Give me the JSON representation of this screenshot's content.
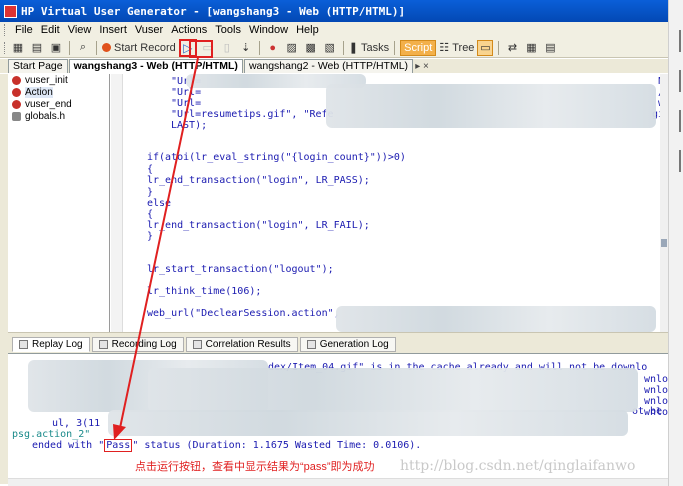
{
  "window": {
    "title": "HP Virtual User Generator - [wangshang3 - Web (HTTP/HTML)]"
  },
  "menu": {
    "items": [
      "File",
      "Edit",
      "View",
      "Insert",
      "Vuser",
      "Actions",
      "Tools",
      "Window",
      "Help"
    ]
  },
  "toolbar": {
    "start_record_label": "Start Record",
    "play_icon": "▷",
    "tasks_label": "Tasks",
    "script_label": "Script",
    "tree_label": "Tree"
  },
  "doc_tabs": {
    "items": [
      "Start Page",
      "wangshang3 - Web (HTTP/HTML)",
      "wangshang2 - Web (HTTP/HTML)"
    ],
    "close_glyph": "▸ ×"
  },
  "tree": {
    "items": [
      "vuser_init",
      "Action",
      "vuser_end",
      "globals.h"
    ]
  },
  "code": {
    "lines": [
      "\"Url=",
      "\"Url=",
      "\"Url=",
      "\"Url=resumetips.gif\", \"Refe",
      "LAST);",
      "if(atoi(lr_eval_string(\"{login_count}\"))>0)",
      "{",
      "lr_end_transaction(\"login\", LR_PASS);",
      "}",
      "else",
      "{",
      "lr_end_transaction(\"login\", LR_FAIL);",
      "}",
      "lr_start_transaction(\"logout\");",
      "lr_think_time(106);",
      "web_url(\"DeclearSession.action\","
    ],
    "right_fragments": [
      "N",
      "/",
      "w",
      "gi"
    ]
  },
  "output_tabs": {
    "items": [
      "Replay Log",
      "Recording Log",
      "Correlation Results",
      "Generation Log"
    ]
  },
  "log": {
    "top_line": "dex/Item_04.gif\" is in the cache already and will not be downlo",
    "right_fragments": [
      "wnlo",
      "wnlo",
      "wnlo",
      "wnlo",
      "ot be"
    ],
    "mid_line_left": "ul, 3(11",
    "mid_line_right": "psg.action_2\"",
    "ended_prefix": "ended with \"",
    "pass_word": "Pass",
    "ended_suffix": "\" status (Duration: 1.1675 Wasted Time: 0.0106)."
  },
  "annotation": {
    "text": "点击运行按钮，查看中显示结果为“pass”即为成功"
  },
  "watermark": {
    "text": "http://blog.csdn.net/qinglaifanwo"
  }
}
